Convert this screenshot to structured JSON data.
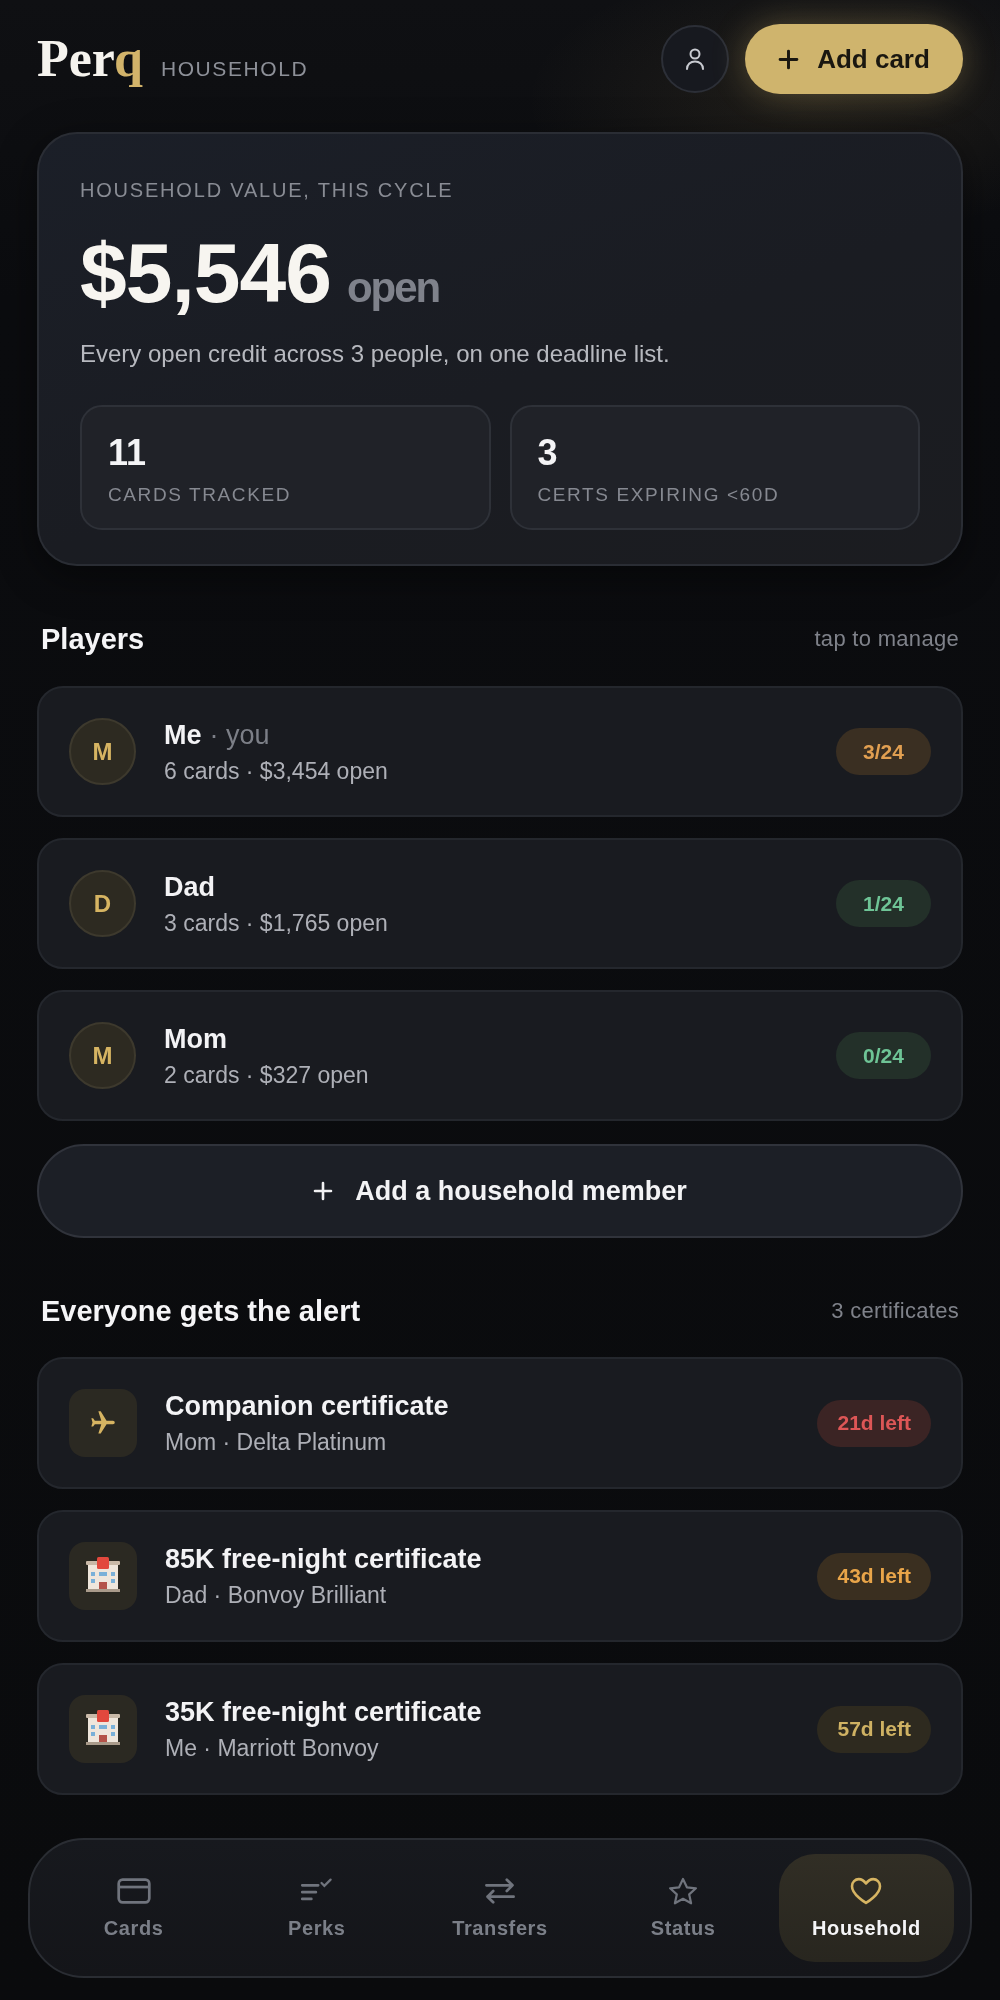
{
  "header": {
    "logo": {
      "main": "Per",
      "accent": "q"
    },
    "section": "HOUSEHOLD",
    "add_label": "Add card"
  },
  "summary": {
    "label": "HOUSEHOLD VALUE, THIS CYCLE",
    "amount": "$5,546",
    "amount_suffix": "open",
    "note": "Every open credit across 3 people, on one deadline list.",
    "stats": [
      {
        "value": "11",
        "label": "CARDS TRACKED"
      },
      {
        "value": "3",
        "label": "CERTS EXPIRING <60D"
      }
    ]
  },
  "players": {
    "title": "Players",
    "hint": "tap to manage",
    "items": [
      {
        "initial": "M",
        "name": "Me",
        "tag": "· you",
        "detail": "6 cards · $3,454 open",
        "badge": {
          "text": "3/24",
          "color": "#3a2f22"
        }
      },
      {
        "initial": "D",
        "name": "Dad",
        "detail": "3 cards · $1,765 open",
        "badge": {
          "text": "1/24",
          "color": "#233029"
        }
      },
      {
        "initial": "M",
        "name": "Mom",
        "detail": "2 cards · $327 open",
        "badge": {
          "text": "0/24",
          "color": "#233029"
        }
      }
    ],
    "add_label": "Add a household member"
  },
  "alerts": {
    "title": "Everyone gets the alert",
    "count": "3 certificates",
    "items": [
      {
        "kind": "flight",
        "title": "Companion certificate",
        "detail": "Mom · Delta Platinum",
        "badge": {
          "text": "21d left",
          "color": "#3b2424"
        }
      },
      {
        "kind": "hotel",
        "title": "85K free-night certificate",
        "detail": "Dad · Bonvoy Brilliant",
        "badge": {
          "text": "43d left",
          "color": "#3a2f20"
        }
      },
      {
        "kind": "hotel",
        "title": "35K free-night certificate",
        "detail": "Me · Marriott Bonvoy",
        "badge": {
          "text": "57d left",
          "color": "#2e2a1f"
        }
      }
    ]
  },
  "nav": {
    "items": [
      {
        "kind": "cards",
        "label": "Cards",
        "selected": false
      },
      {
        "kind": "perks",
        "label": "Perks",
        "selected": false
      },
      {
        "kind": "transfers",
        "label": "Transfers",
        "selected": false
      },
      {
        "kind": "status",
        "label": "Status",
        "selected": false
      },
      {
        "kind": "household",
        "label": "Household",
        "selected": true
      }
    ]
  }
}
